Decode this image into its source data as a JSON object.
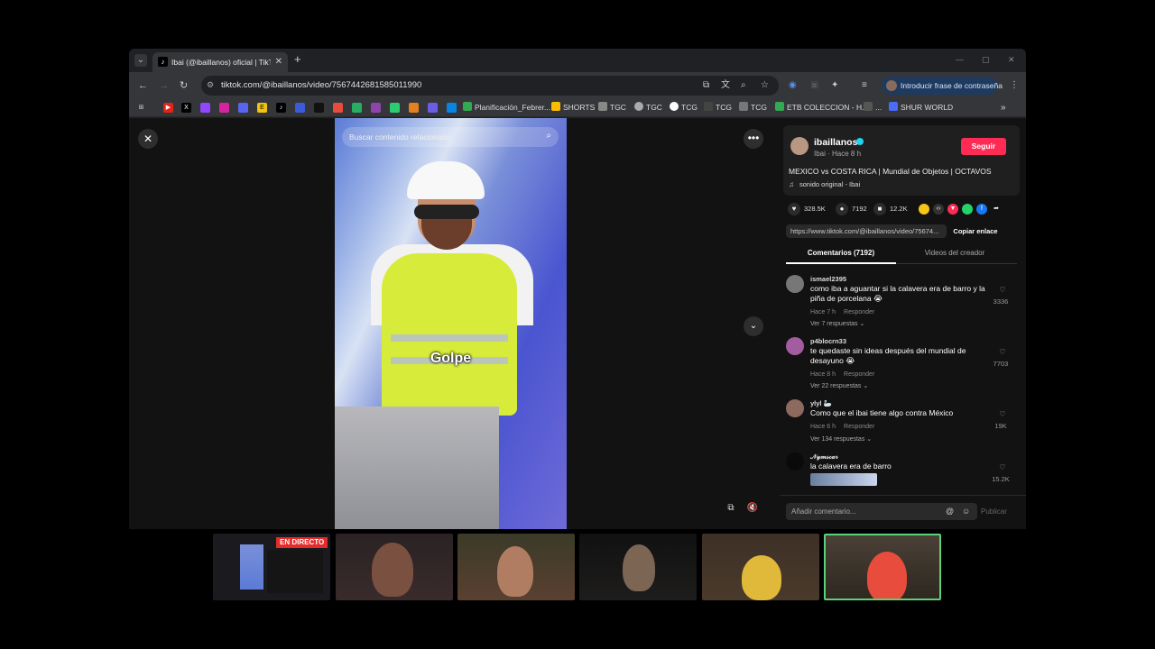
{
  "browser": {
    "tab_title": "Ibai (@ibaillanos) oficial | TikTok",
    "url": "tiktok.com/@ibaillanos/video/7567442681585011990",
    "passkey_label": "Introducir frase de contraseña"
  },
  "bookmarks": [
    {
      "label": "Planificación_Febrer..."
    },
    {
      "label": "SHORTS"
    },
    {
      "label": "TGC"
    },
    {
      "label": "TGC"
    },
    {
      "label": "TCG"
    },
    {
      "label": "TCG"
    },
    {
      "label": "TCG"
    },
    {
      "label": "ETB COLECCION - H..."
    },
    {
      "label": "..."
    },
    {
      "label": "SHUR WORLD"
    }
  ],
  "video": {
    "search_placeholder": "Buscar contenido relacionado",
    "caption": "Golpe"
  },
  "creator": {
    "name": "ibaillanos",
    "subtitle": "Ibai · Hace 8 h",
    "follow_label": "Seguir",
    "description": "MEXICO vs COSTA RICA | Mundial de Objetos | OCTAVOS",
    "music": "sonido original - Ibai"
  },
  "stats": {
    "likes": "328.5K",
    "comments": "7192",
    "saves": "12.2K"
  },
  "link": {
    "url": "https://www.tiktok.com/@ibaillanos/video/75674...",
    "copy_label": "Copiar enlace"
  },
  "tabs": {
    "comments": "Comentarios (7192)",
    "creator_videos": "Videos del creador"
  },
  "comments": [
    {
      "user": "ismael2395",
      "text": "como iba a aguantar si la calavera era de barro y la piña de porcelana 😭",
      "time": "Hace 7 h",
      "reply": "Responder",
      "replies": "Ver 7 respuestas ⌄",
      "likes": "3336"
    },
    {
      "user": "p4blocrn33",
      "text": "te quedaste sin ideas después del mundial de desayuno 😭",
      "time": "Hace 8 h",
      "reply": "Responder",
      "replies": "Ver 22 respuestas ⌄",
      "likes": "7703"
    },
    {
      "user": "ylyl 🦢",
      "text": "Como que el ibai tiene algo contra México",
      "time": "Hace 6 h",
      "reply": "Responder",
      "replies": "Ver 134 respuestas ⌄",
      "likes": "19K"
    },
    {
      "user": "𝒩𝓎𝓂𝓈𝒸𝒶𝓇",
      "text": "la calavera era de barro",
      "likes": "15.2K"
    }
  ],
  "comment_bar": {
    "placeholder": "Añadir comentario...",
    "post_label": "Publicar"
  },
  "stream": {
    "live_badge": "EN DIRECTO"
  }
}
